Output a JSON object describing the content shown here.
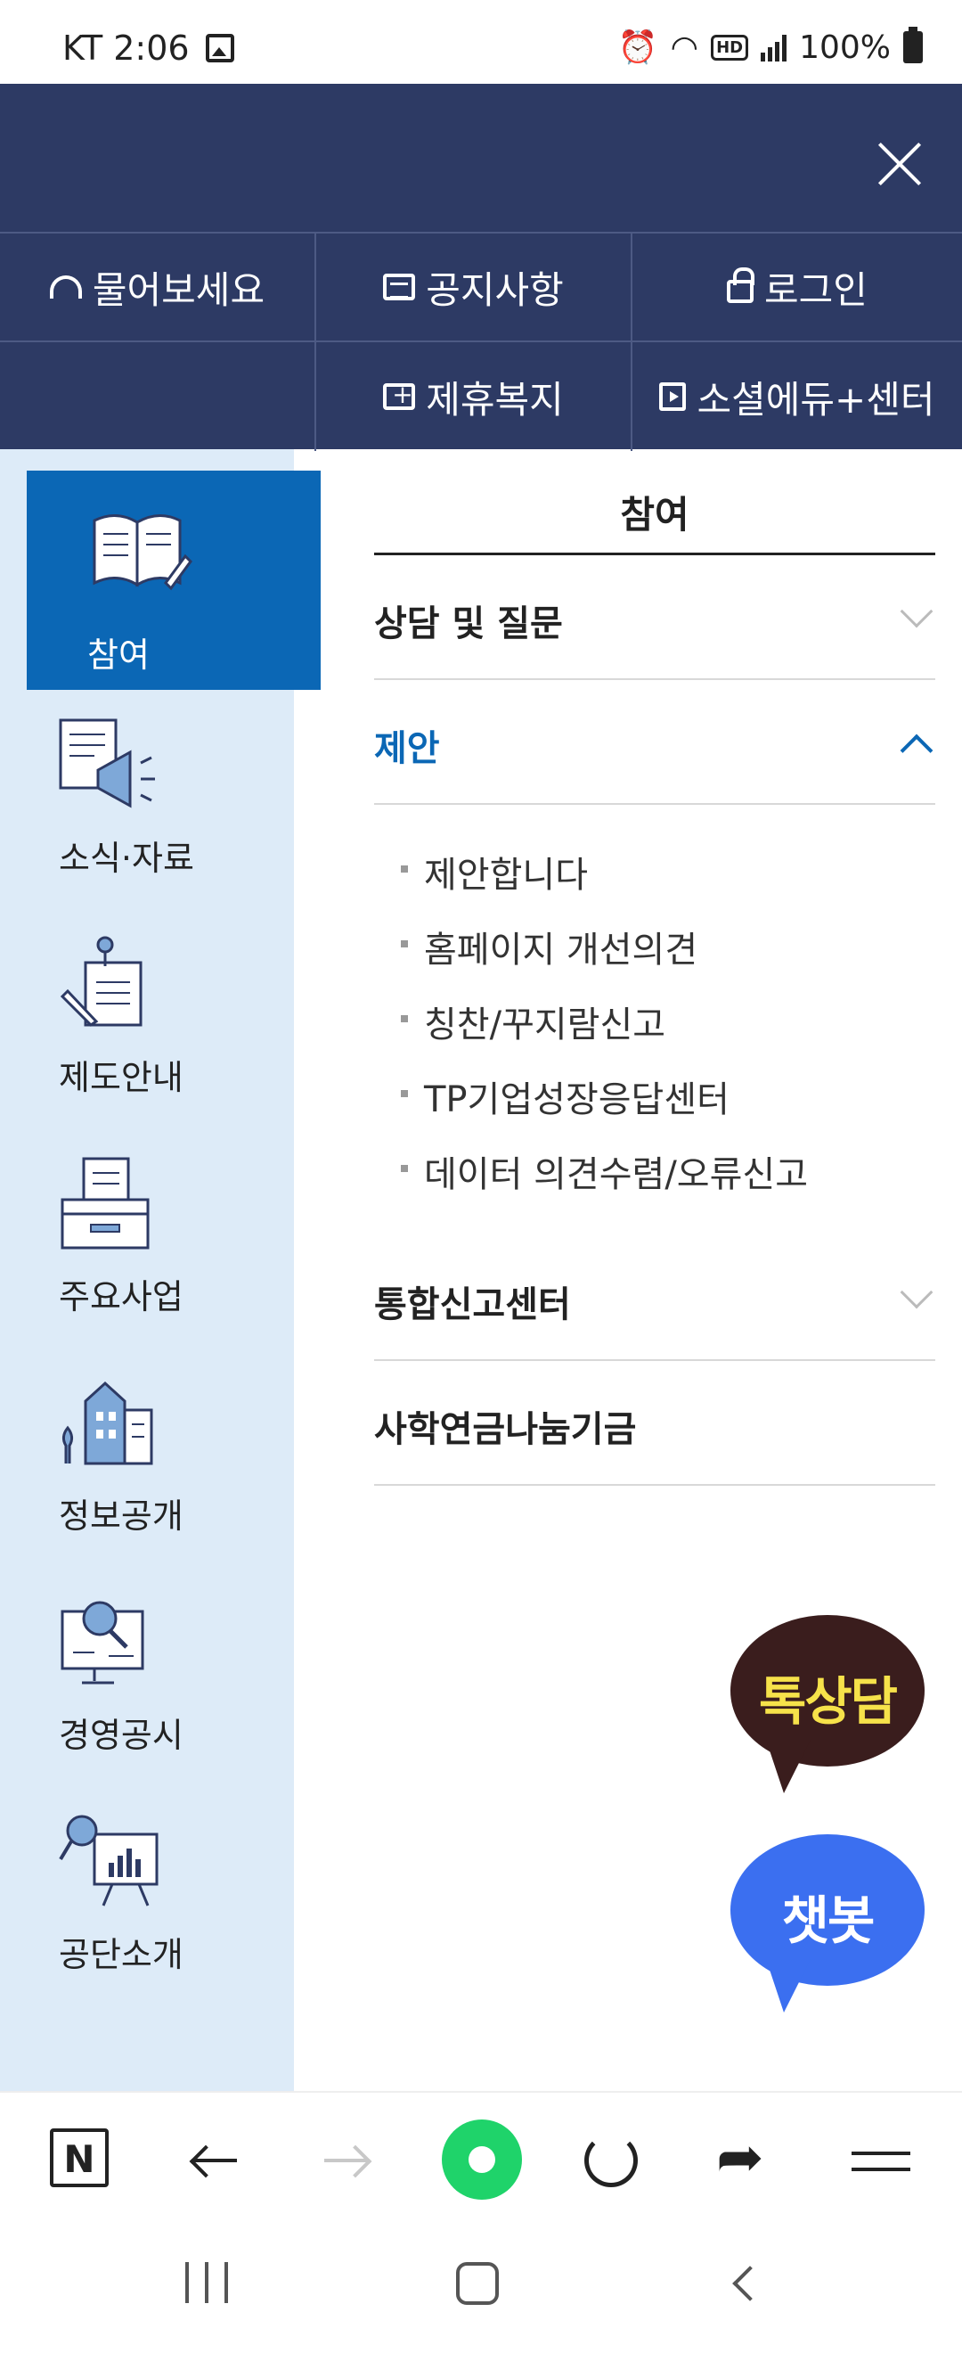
{
  "status_bar": {
    "carrier_time": "KT 2:06",
    "battery": "100%"
  },
  "header": {
    "menu": [
      {
        "label": "물어보세요",
        "icon": "headset-icon"
      },
      {
        "label": "공지사항",
        "icon": "notice-icon"
      },
      {
        "label": "로그인",
        "icon": "lock-icon"
      },
      {
        "label": "제휴복지",
        "icon": "first-aid-kit-icon"
      },
      {
        "label": "소셜에듀+센터",
        "icon": "video-icon"
      }
    ]
  },
  "sidebar": {
    "items": [
      {
        "label": "참여",
        "icon": "open-book-icon",
        "active": true
      },
      {
        "label": "소식·자료",
        "icon": "megaphone-icon",
        "active": false
      },
      {
        "label": "제도안내",
        "icon": "document-pen-icon",
        "active": false
      },
      {
        "label": "주요사업",
        "icon": "inbox-tray-icon",
        "active": false
      },
      {
        "label": "정보공개",
        "icon": "building-icon",
        "active": false
      },
      {
        "label": "경영공시",
        "icon": "monitor-search-icon",
        "active": false
      },
      {
        "label": "공단소개",
        "icon": "presentation-board-icon",
        "active": false
      }
    ]
  },
  "content": {
    "title": "참여",
    "sections": [
      {
        "label": "상담 및 질문",
        "expanded": false
      },
      {
        "label": "제안",
        "expanded": true
      },
      {
        "label": "통합신고센터",
        "expanded": false
      },
      {
        "label": "사학연금나눔기금",
        "expanded": false
      }
    ],
    "sub_items": [
      "제안합니다",
      "홈페이지 개선의견",
      "칭찬/꾸지람신고",
      "TP기업성장응답센터",
      "데이터 의견수렴/오류신고"
    ]
  },
  "floating": {
    "talk": "톡상담",
    "chatbot": "챗봇"
  },
  "toolbar": {
    "n_label": "N"
  },
  "colors": {
    "header_bg": "#2d3a64",
    "sidebar_bg": "#ddebf8",
    "active_blue": "#0b67b5",
    "talk_bg": "#3a1d1d",
    "talk_text": "#f6e24a",
    "chatbot_bg": "#3b6ff0",
    "browser_green": "#1fd36a"
  }
}
